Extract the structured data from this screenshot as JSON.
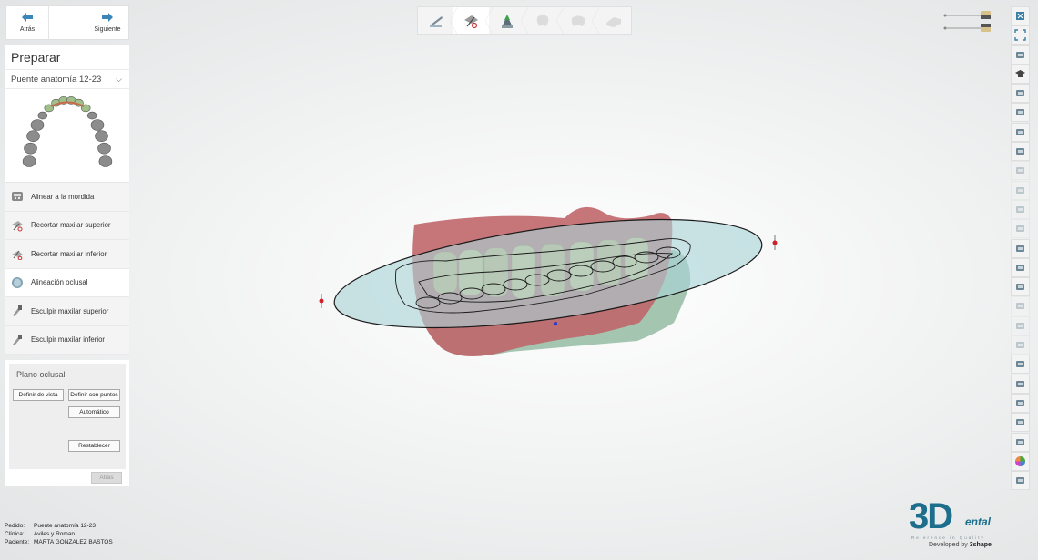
{
  "nav": {
    "back_label": "Atrás",
    "next_label": "Siguiente"
  },
  "panel": {
    "title": "Preparar",
    "preset": "Puente anatomía 12-23",
    "steps": [
      {
        "label": "Alinear a la mordida",
        "icon": "bite-align-icon"
      },
      {
        "label": "Recortar maxilar superior",
        "icon": "trim-upper-icon"
      },
      {
        "label": "Recortar maxilar inferior",
        "icon": "trim-lower-icon"
      },
      {
        "label": "Alineación oclusal",
        "icon": "occlusal-align-icon"
      },
      {
        "label": "Esculpir maxilar superior",
        "icon": "sculpt-upper-icon"
      },
      {
        "label": "Esculpir maxilar inferior",
        "icon": "sculpt-lower-icon"
      }
    ],
    "active_step": "Alineación oclusal"
  },
  "occlusal": {
    "title": "Plano oclusal",
    "define_view": "Definir de vista",
    "define_points": "Definir con puntos",
    "automatic": "Automático",
    "reset": "Restablecer",
    "back": "Atrás"
  },
  "info": {
    "order_key": "Pedido:",
    "order_val": "Puente anatomía 12-23",
    "clinic_key": "Clínica:",
    "clinic_val": "Aviles y Roman",
    "patient_key": "Paciente:",
    "patient_val": "MARTA GONZALEZ BASTOS"
  },
  "logo": {
    "mark": "3D",
    "ental": "ental",
    "tagline": "Reference in Quality",
    "developed": "Developed by",
    "brand": "3shape"
  },
  "colors": {
    "accent": "#1c6e8c",
    "gum": "#c0666a",
    "plane": "#a9d3d6",
    "marker": "#d0202a"
  },
  "workflow": [
    "scan-tool-icon",
    "trim-tools-icon",
    "prepare-model-icon",
    "tooth-design-icon",
    "tooth-anatomy-icon",
    "model-base-icon"
  ],
  "right_tools": [
    "close-window-icon",
    "fullscreen-icon",
    "view-cube-icon",
    "tutor-cap-icon",
    "view-front-icon",
    "view-back-icon",
    "view-left-icon",
    "view-right-icon",
    "pan-icon",
    "zoom-icon",
    "zoom-fit-icon",
    "rotate-icon",
    "upper-jaw-icon",
    "lower-jaw-icon",
    "jaw-both-icon",
    "tooth-icon",
    "warning-icon",
    "section-icon",
    "camera-icon",
    "scan-model-icon",
    "crosshair-icon",
    "ruler-icon",
    "building-icon",
    "color-wheel-icon",
    "antagonist-icon"
  ]
}
